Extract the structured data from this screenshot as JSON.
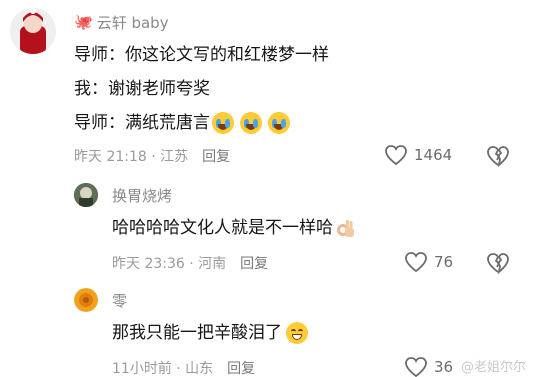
{
  "comments": [
    {
      "username": "云轩 baby",
      "lines": [
        "导师：你这论文写的和红楼梦一样",
        "我：谢谢老师夸奖",
        "导师：满纸荒唐言"
      ],
      "emoji_count": 3,
      "meta": "昨天 21:18 · 江苏",
      "reply_label": "回复",
      "likes": "1464"
    },
    {
      "username": "换胃烧烤",
      "text": "哈哈哈哈文化人就是不一样哈",
      "meta": "昨天 23:36 · 河南",
      "reply_label": "回复",
      "likes": "76"
    },
    {
      "username": "零",
      "text": "那我只能一把辛酸泪了",
      "meta": "11小时前 · 山东",
      "reply_label": "回复",
      "likes": "36"
    }
  ],
  "icons": {
    "like": "heart-outline-icon",
    "dislike": "broken-heart-icon",
    "emoji_cry": "laugh-cry-emoji",
    "emoji_smile": "grin-emoji",
    "ok": "ok-hand-emoji"
  },
  "watermark": "@老姐尔尔"
}
